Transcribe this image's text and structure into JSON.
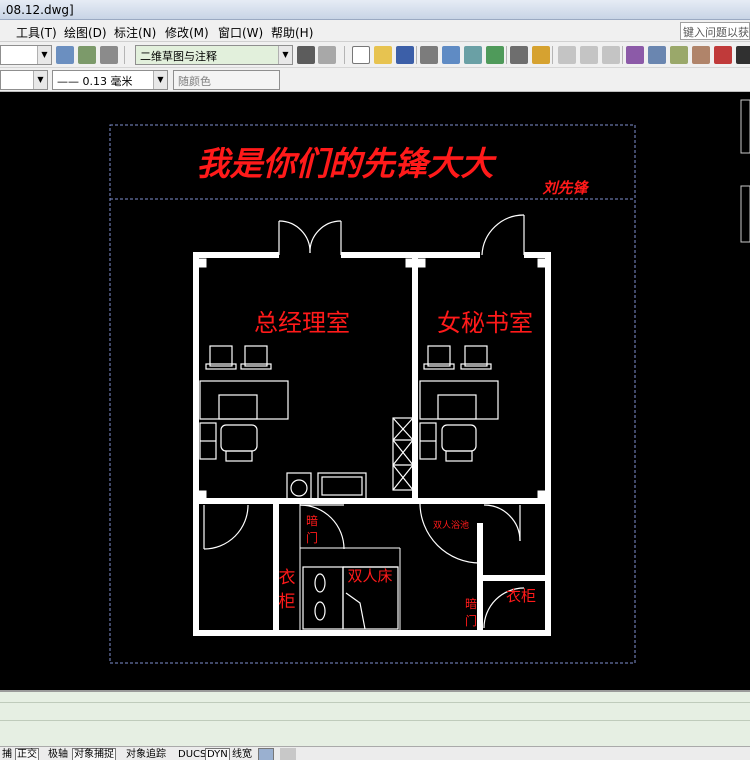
{
  "window": {
    "title": ".08.12.dwg]"
  },
  "menu": {
    "items": [
      "工具(T)",
      "绘图(D)",
      "标注(N)",
      "修改(M)",
      "窗口(W)",
      "帮助(H)"
    ],
    "help_search": "键入问题以获取"
  },
  "toolbar": {
    "workspace": "二维草图与注释",
    "lineweight": "—— 0.13 毫米",
    "color": "随颜色"
  },
  "drawing": {
    "title": "我是你们的先锋大大",
    "author": "刘先锋",
    "rooms": {
      "manager": "总经理室",
      "secretary": "女秘书室",
      "wardrobe_left": [
        "衣",
        "柜"
      ],
      "double_bed": "双人床",
      "wardrobe_right": "衣柜",
      "dark_door_left": [
        "暗",
        "门"
      ],
      "dark_door_right": [
        "暗",
        "门"
      ],
      "double_bath": "双人浴池"
    }
  },
  "status": {
    "buttons": [
      "捕",
      "正交",
      "极轴",
      "对象捕捉",
      "对象追踪",
      "DUCS",
      "DYN",
      "线宽"
    ]
  },
  "colors": {
    "drawing_red": "#ff1a1a",
    "wall": "#ffffff",
    "frame_blue": "#7f8fcf",
    "background": "#000000"
  }
}
